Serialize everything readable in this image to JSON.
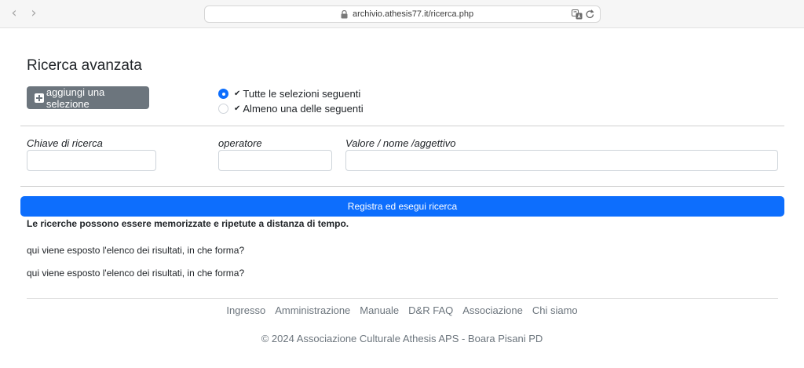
{
  "browser": {
    "url": "archivio.athesis77.it/ricerca.php",
    "back_icon": "‹",
    "forward_icon": "›"
  },
  "page": {
    "title": "Ricerca avanzata",
    "add_selection_label": "aggiungi una selezione",
    "match_options": [
      {
        "label": "Tutte le selezioni seguenti",
        "checked": true
      },
      {
        "label": "Almeno una delle seguenti",
        "checked": false
      }
    ],
    "fields": {
      "key_label": "Chiave di ricerca",
      "operator_label": "operatore",
      "value_label": "Valore / nome /aggettivo",
      "key_value": "",
      "operator_value": "",
      "value_value": ""
    },
    "submit_label": "Registra ed esegui ricerca",
    "note": "Le ricerche possono essere memorizzate e ripetute a distanza di tempo.",
    "results_text_1": "qui viene esposto l'elenco dei risultati, in che forma?",
    "results_text_2": "qui viene esposto l'elenco dei risultati, in che forma?"
  },
  "footer": {
    "links": [
      "Ingresso",
      "Amministrazione",
      "Manuale",
      "D&R FAQ",
      "Associazione",
      "Chi siamo"
    ],
    "copyright": "© 2024 Associazione Culturale Athesis APS - Boara Pisani PD"
  },
  "colors": {
    "primary": "#0d6efd",
    "secondary": "#6c757d"
  }
}
